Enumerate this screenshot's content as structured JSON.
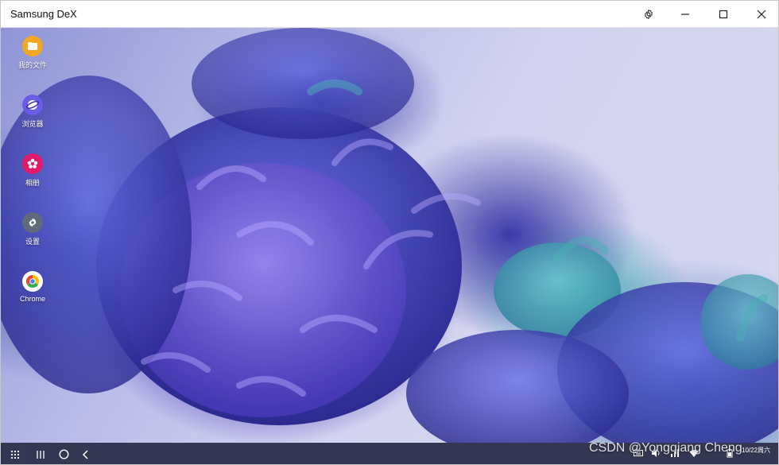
{
  "window": {
    "title": "Samsung DeX",
    "controls": {
      "settings_icon": "gear-icon",
      "minimize_icon": "minimize-icon",
      "maximize_icon": "maximize-icon",
      "close_icon": "close-icon"
    }
  },
  "desktop": {
    "icons": [
      {
        "label": "我的文件",
        "icon": "folder-icon",
        "color": "#f5a623"
      },
      {
        "label": "浏览器",
        "icon": "browser-icon",
        "color": "#6b5ce7"
      },
      {
        "label": "相册",
        "icon": "gallery-icon",
        "color": "#e3196a"
      },
      {
        "label": "设置",
        "icon": "settings-icon",
        "color": "#5f6b7a"
      },
      {
        "label": "Chrome",
        "icon": "chrome-icon",
        "color": "#ffffff"
      }
    ]
  },
  "taskbar": {
    "apps_icon": "apps-grid-icon",
    "recents_icon": "recents-icon",
    "home_icon": "home-icon",
    "back_icon": "back-icon",
    "tray_icons": [
      "keyboard-icon",
      "volume-icon",
      "network-icon",
      "wifi-icon",
      "battery-icon"
    ],
    "clock": {
      "line1": "",
      "line2": "10/22周六"
    }
  },
  "watermark": "CSDN @Yongqiang Cheng"
}
